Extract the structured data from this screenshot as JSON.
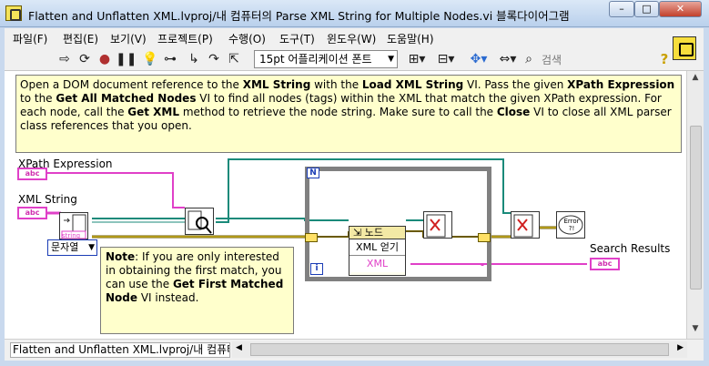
{
  "window": {
    "title": "Flatten and Unflatten XML.lvproj/내 컴퓨터의 Parse XML String for Multiple Nodes.vi 블록다이어그램",
    "minimize": "–",
    "maximize": "□",
    "close": "✕"
  },
  "menu": [
    "파일(F)",
    "편집(E)",
    "보기(V)",
    "프로젝트(P)",
    "수행(O)",
    "도구(T)",
    "윈도우(W)",
    "도움말(H)"
  ],
  "toolbar": {
    "font_selector": "15pt 어플리케이션 폰트",
    "search_placeholder": "검색",
    "help": "?"
  },
  "diagram": {
    "comment": {
      "p1": "Open a DOM document reference to the ",
      "b1": "XML String",
      "p2": " with the ",
      "b2": "Load XML String",
      "p3": " VI. Pass the given ",
      "b3": "XPath Expression",
      "p4": " to the ",
      "b4": "Get All Matched Nodes",
      "p5": " VI to find all nodes (tags) within the XML that match the given XPath expression. For each node, call the ",
      "b5": "Get XML",
      "p6": " method to retrieve the node string. Make sure to call the ",
      "b6": "Close",
      "p7": " VI to close all XML parser class references that you open."
    },
    "labels": {
      "xpath": "XPath Expression",
      "xml_string": "XML String",
      "search_results": "Search Results"
    },
    "control_tag": "abc",
    "string_tag": "string",
    "loop_count": "N",
    "loop_index": "i",
    "enum_value": "문자열",
    "invoke_node": {
      "header": "노드",
      "method": "XML 얻기",
      "output": "XML"
    },
    "error_icon": "Error ?!",
    "note": {
      "b1": "Note",
      "p1": ": If you are only interested in obtaining the first match, you can use the ",
      "b2": "Get First Matched Node",
      "p2": " VI instead."
    }
  },
  "statusbar": {
    "path": "Flatten and Unflatten XML.lvproj/내 컴퓨터"
  }
}
